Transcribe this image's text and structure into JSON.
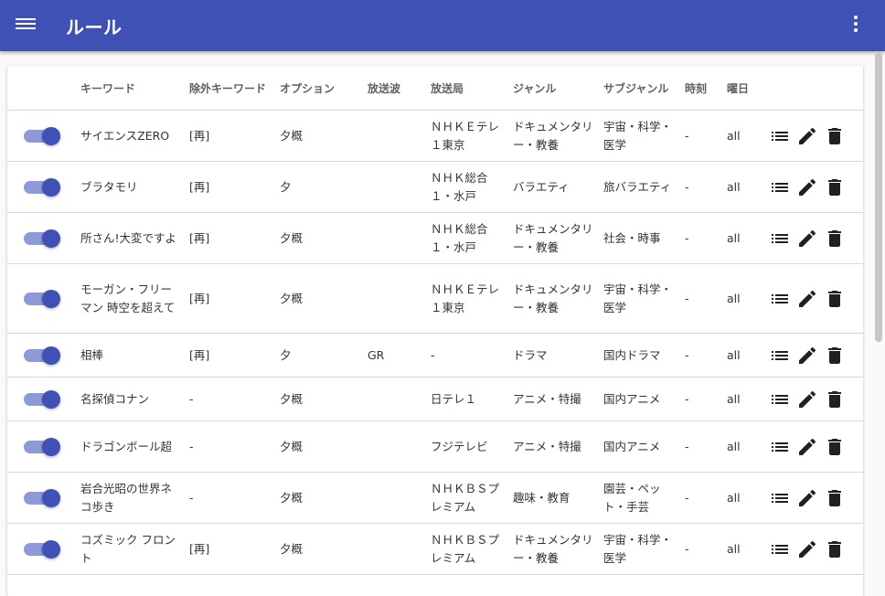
{
  "app": {
    "title": "ルール"
  },
  "table": {
    "headers": {
      "keyword": "キーワード",
      "exclude": "除外キーワード",
      "option": "オプション",
      "broadcast": "放送波",
      "station": "放送局",
      "genre": "ジャンル",
      "subgenre": "サブジャンル",
      "time": "時刻",
      "day": "曜日"
    },
    "rows": [
      {
        "enabled": true,
        "keyword": "サイエンスZERO",
        "exclude": "[再]",
        "option": "夕概",
        "broadcast": "",
        "station": "ＮＨＫＥテレ１東京",
        "genre": "ドキュメンタリー・教養",
        "subgenre": "宇宙・科学・医学",
        "time": "-",
        "day": "all"
      },
      {
        "enabled": true,
        "keyword": "ブラタモリ",
        "exclude": "[再]",
        "option": "夕",
        "broadcast": "",
        "station": "ＮＨＫ総合１・水戸",
        "genre": "バラエティ",
        "subgenre": "旅バラエティ",
        "time": "-",
        "day": "all"
      },
      {
        "enabled": true,
        "keyword": "所さん!大変ですよ",
        "exclude": "[再]",
        "option": "夕概",
        "broadcast": "",
        "station": "ＮＨＫ総合１・水戸",
        "genre": "ドキュメンタリー・教養",
        "subgenre": "社会・時事",
        "time": "-",
        "day": "all"
      },
      {
        "enabled": true,
        "keyword": "モーガン・フリーマン 時空を超えて",
        "exclude": "[再]",
        "option": "夕概",
        "broadcast": "",
        "station": "ＮＨＫＥテレ１東京",
        "genre": "ドキュメンタリー・教養",
        "subgenre": "宇宙・科学・医学",
        "time": "-",
        "day": "all"
      },
      {
        "enabled": true,
        "keyword": "相棒",
        "exclude": "[再]",
        "option": "夕",
        "broadcast": "GR",
        "station": "-",
        "genre": "ドラマ",
        "subgenre": "国内ドラマ",
        "time": "-",
        "day": "all"
      },
      {
        "enabled": true,
        "keyword": "名探偵コナン",
        "exclude": "-",
        "option": "夕概",
        "broadcast": "",
        "station": "日テレ１",
        "genre": "アニメ・特撮",
        "subgenre": "国内アニメ",
        "time": "-",
        "day": "all"
      },
      {
        "enabled": true,
        "keyword": "ドラゴンボール超",
        "exclude": "-",
        "option": "夕概",
        "broadcast": "",
        "station": "フジテレビ",
        "genre": "アニメ・特撮",
        "subgenre": "国内アニメ",
        "time": "-",
        "day": "all"
      },
      {
        "enabled": true,
        "keyword": "岩合光昭の世界ネコ歩き",
        "exclude": "-",
        "option": "夕概",
        "broadcast": "",
        "station": "ＮＨＫＢＳプレミアム",
        "genre": "趣味・教育",
        "subgenre": "園芸・ペット・手芸",
        "time": "-",
        "day": "all"
      },
      {
        "enabled": true,
        "keyword": "コズミック フロント",
        "exclude": "[再]",
        "option": "夕概",
        "broadcast": "",
        "station": "ＮＨＫＢＳプレミアム",
        "genre": "ドキュメンタリー・教養",
        "subgenre": "宇宙・科学・医学",
        "time": "-",
        "day": "all"
      }
    ]
  },
  "icons": {
    "menu": "menu-icon",
    "more": "more-vert-icon",
    "list": "list-icon",
    "edit": "pencil-icon",
    "delete": "trash-icon"
  },
  "colors": {
    "primary": "#3f51b5",
    "toggle_track": "#8e99d6"
  }
}
